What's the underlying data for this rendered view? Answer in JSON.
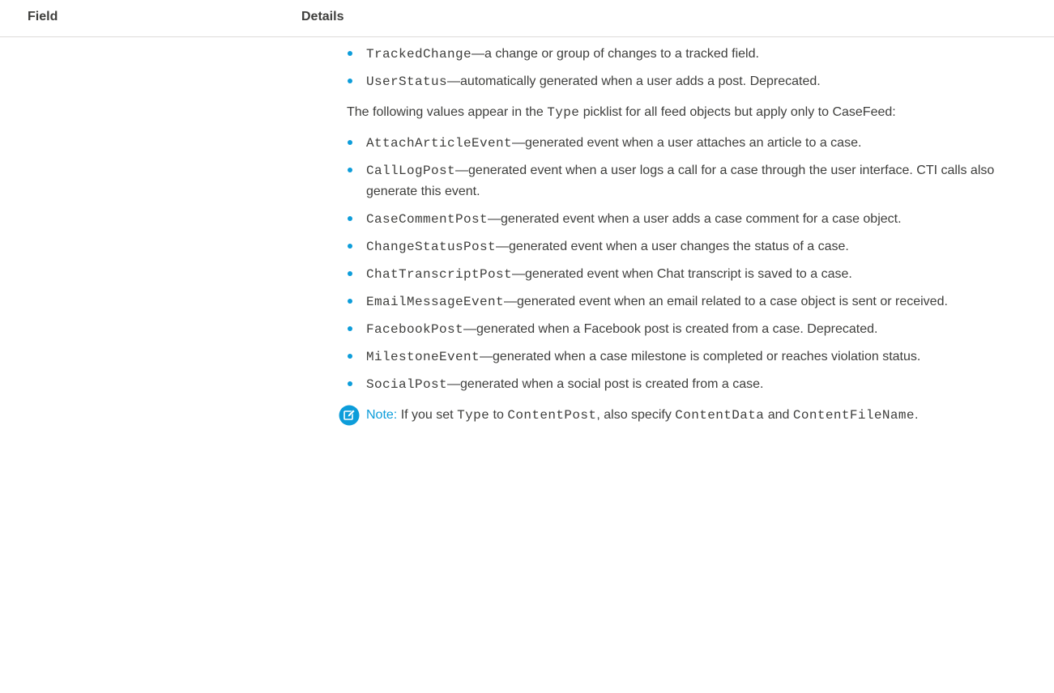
{
  "header": {
    "field": "Field",
    "details": "Details"
  },
  "list1": [
    {
      "code": "TrackedChange",
      "desc": "—a change or group of changes to a tracked field."
    },
    {
      "code": "UserStatus",
      "desc": "—automatically generated when a user adds a post. Deprecated."
    }
  ],
  "para": {
    "before": "The following values appear in the ",
    "code": "Type",
    "after": " picklist for all feed objects but apply only to CaseFeed:"
  },
  "list2": [
    {
      "code": "AttachArticleEvent",
      "desc": "—generated event when a user attaches an article to a case."
    },
    {
      "code": "CallLogPost",
      "desc": "—generated event when a user logs a call for a case through the user interface. CTI calls also generate this event."
    },
    {
      "code": "CaseCommentPost",
      "desc": "—generated event when a user adds a case comment for a case object."
    },
    {
      "code": "ChangeStatusPost",
      "desc": "—generated event when a user changes the status of a case."
    },
    {
      "code": "ChatTranscriptPost",
      "desc": "—generated event when Chat transcript is saved to a case."
    },
    {
      "code": "EmailMessageEvent",
      "desc": "—generated event when an email related to a case object is sent or received."
    },
    {
      "code": "FacebookPost",
      "desc": "—generated when a Facebook post is created from a case. Deprecated."
    },
    {
      "code": "MilestoneEvent",
      "desc": "—generated when a case milestone is completed or reaches violation status."
    },
    {
      "code": "SocialPost",
      "desc": "—generated when a social post is created from a case."
    }
  ],
  "note": {
    "label": "Note:",
    "t1": " If you set ",
    "c1": "Type",
    "t2": " to ",
    "c2": "ContentPost",
    "t3": ", also specify ",
    "c3": "ContentData",
    "t4": " and ",
    "c4": "ContentFileName",
    "t5": "."
  },
  "colors": {
    "accent": "#0d9dda",
    "text": "#3e3e3c",
    "divider": "#dddbda"
  },
  "icons": {
    "bullet": "bullet-dot-icon",
    "note": "note-edit-icon"
  }
}
